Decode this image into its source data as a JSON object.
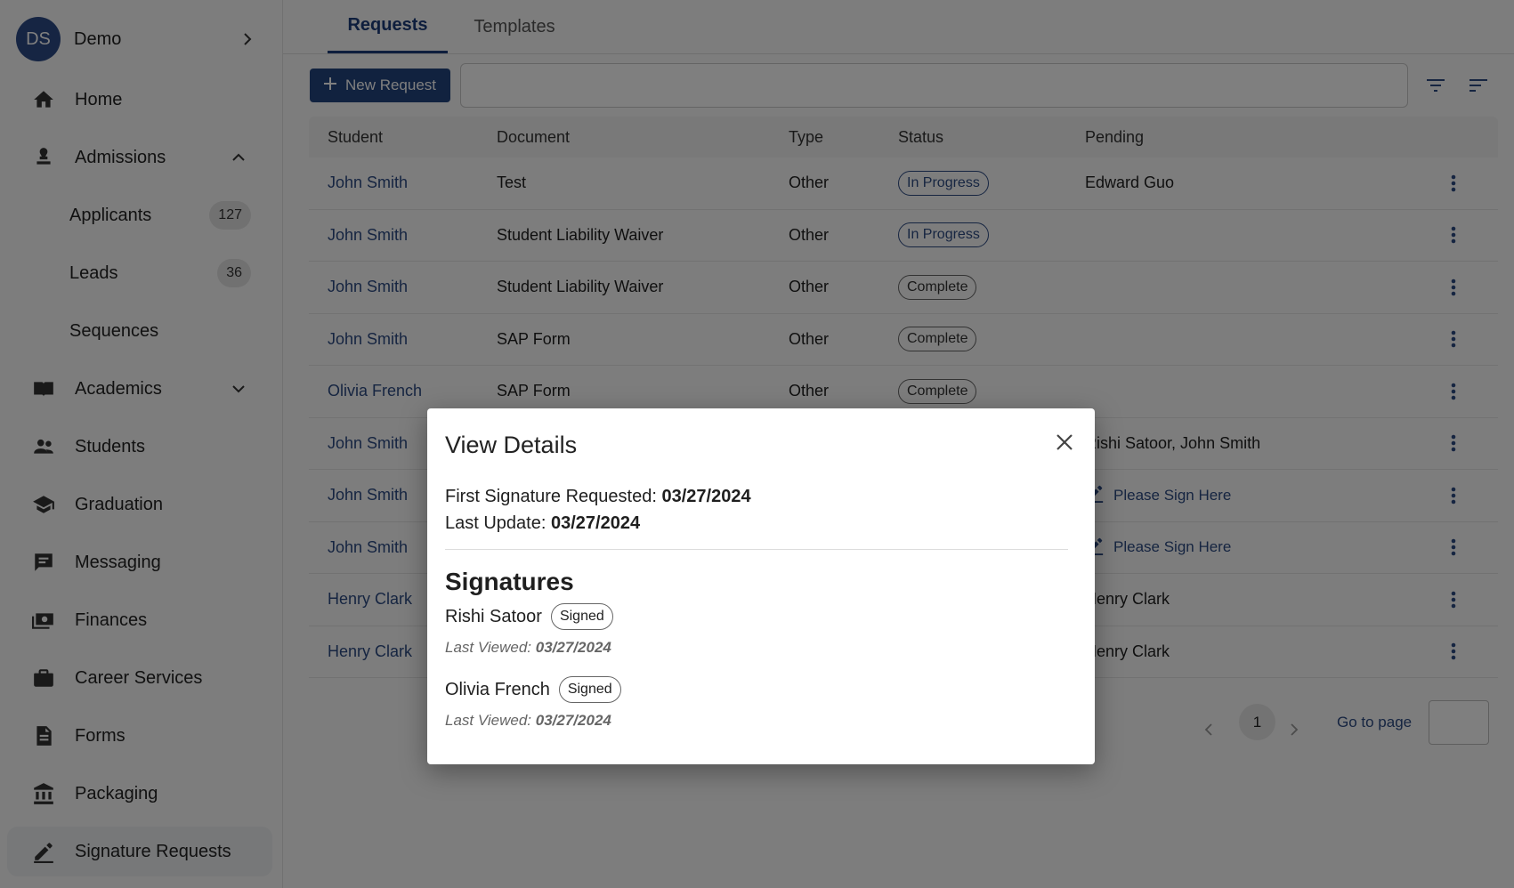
{
  "user": {
    "initials": "DS",
    "name": "Demo"
  },
  "sidebar": {
    "items": [
      {
        "label": "Home"
      },
      {
        "label": "Admissions"
      },
      {
        "label": "Applicants",
        "count": "127"
      },
      {
        "label": "Leads",
        "count": "36"
      },
      {
        "label": "Sequences"
      },
      {
        "label": "Academics"
      },
      {
        "label": "Students"
      },
      {
        "label": "Graduation"
      },
      {
        "label": "Messaging"
      },
      {
        "label": "Finances"
      },
      {
        "label": "Career Services"
      },
      {
        "label": "Forms"
      },
      {
        "label": "Packaging"
      },
      {
        "label": "Signature Requests"
      }
    ]
  },
  "tabs": [
    {
      "label": "Requests"
    },
    {
      "label": "Templates"
    }
  ],
  "toolbar": {
    "new_request_label": "New Request",
    "search_value": ""
  },
  "table": {
    "headers": {
      "student": "Student",
      "document": "Document",
      "type": "Type",
      "status": "Status",
      "pending": "Pending"
    },
    "rows": [
      {
        "student": "John Smith",
        "document": "Test",
        "type": "Other",
        "status": "In Progress",
        "pending": "Edward Guo"
      },
      {
        "student": "John Smith",
        "document": "Student Liability Waiver",
        "type": "Other",
        "status": "In Progress",
        "pending": ""
      },
      {
        "student": "John Smith",
        "document": "Student Liability Waiver",
        "type": "Other",
        "status": "Complete",
        "pending": ""
      },
      {
        "student": "John Smith",
        "document": "SAP Form",
        "type": "Other",
        "status": "Complete",
        "pending": ""
      },
      {
        "student": "Olivia French",
        "document": "SAP Form",
        "type": "Other",
        "status": "Complete",
        "pending": ""
      },
      {
        "student": "John Smith",
        "document": "",
        "type": "",
        "status": "",
        "pending": "Rishi Satoor, John Smith"
      },
      {
        "student": "John Smith",
        "document": "",
        "type": "",
        "status": "",
        "pending": "Please Sign Here"
      },
      {
        "student": "John Smith",
        "document": "",
        "type": "",
        "status": "",
        "pending": "Please Sign Here"
      },
      {
        "student": "Henry Clark",
        "document": "",
        "type": "",
        "status": "",
        "pending": "Henry Clark"
      },
      {
        "student": "Henry Clark",
        "document": "",
        "type": "",
        "status": "",
        "pending": "Henry Clark"
      }
    ]
  },
  "pagination": {
    "current_page": "1",
    "goto_label": "Go to page",
    "goto_value": ""
  },
  "modal": {
    "title": "View Details",
    "first_sig_label": "First Signature Requested:",
    "first_sig_value": "03/27/2024",
    "last_update_label": "Last Update:",
    "last_update_value": "03/27/2024",
    "signatures_heading": "Signatures",
    "signers": [
      {
        "name": "Rishi Satoor",
        "status": "Signed",
        "viewed_label": "Last Viewed:",
        "viewed_value": "03/27/2024"
      },
      {
        "name": "Olivia French",
        "status": "Signed",
        "viewed_label": "Last Viewed:",
        "viewed_value": "03/27/2024"
      }
    ]
  },
  "colors": {
    "primary": "#23457f",
    "link": "#2c4a83",
    "avatar": "#2d4a87"
  }
}
